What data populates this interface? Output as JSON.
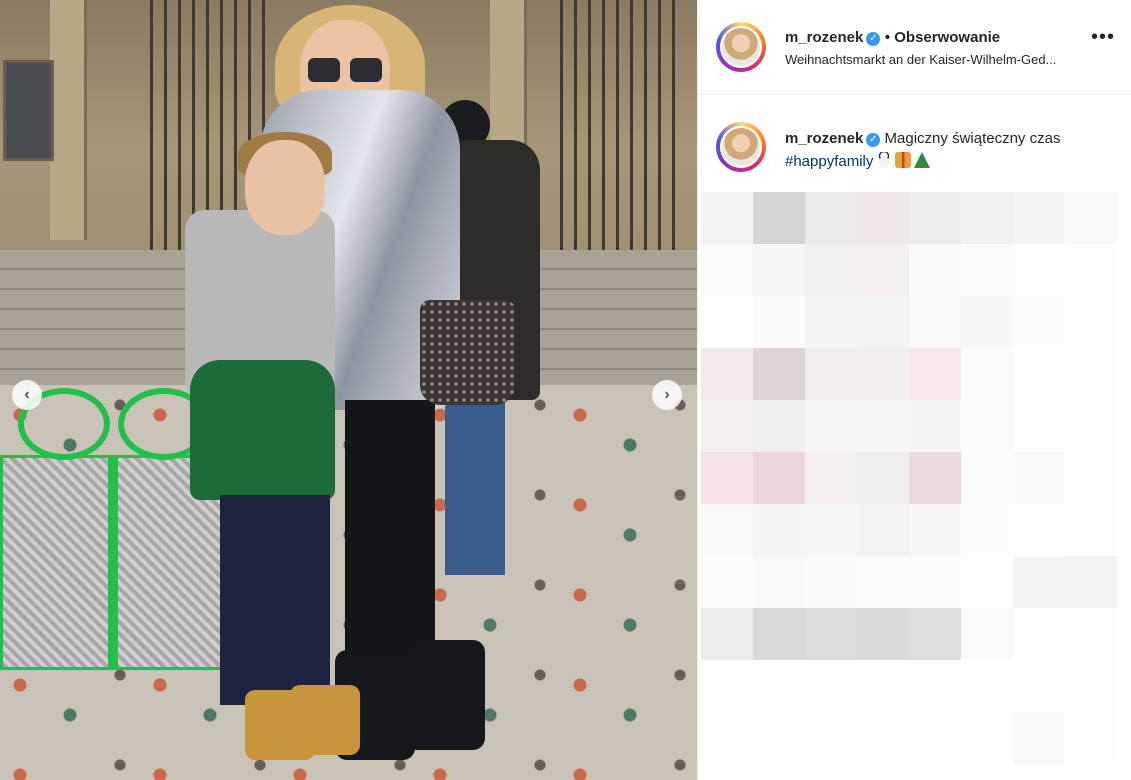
{
  "post": {
    "author": {
      "username": "m_rozenek",
      "verified": true,
      "follow_label": "• Obserwowanie",
      "location": "Weihnachtsmarkt an der Kaiser-Wilhelm-Ged..."
    },
    "more_options_label": "•••",
    "caption": {
      "username": "m_rozenek",
      "text_before": "Magiczny świąteczny czas",
      "hashtag": "#happyfamily",
      "emojis": [
        "snowman-icon",
        "gift-icon",
        "christmas-tree-icon"
      ]
    },
    "carousel": {
      "prev_label": "‹",
      "next_label": "›"
    }
  },
  "colors": {
    "accent_blue": "#3897f0",
    "hashtag": "#00376b",
    "text": "#262626",
    "border": "#efefef"
  },
  "pixelated_tiles": [
    "#f4f4f4",
    "#d6d6d6",
    "#eaeaea",
    "#efe6e6",
    "#ececec",
    "#f1f1f1",
    "#f5f5f5",
    "#fafafa",
    "#fbfbfb",
    "#f6f6f6",
    "#f1f1f1",
    "#f5f1f1",
    "#fafafa",
    "#fbfbfb",
    "#fdfdfd",
    "#fefefe",
    "#fdfdfd",
    "#fafafa",
    "#f5f5f5",
    "#f3f3f3",
    "#f8f8f8",
    "#f7f7f7",
    "#fcfcfc",
    "#fefefe",
    "#f2eaea",
    "#ddd5d5",
    "#f3eeee",
    "#f2eeee",
    "#f6e8e8",
    "#fbfbfb",
    "#fefefe",
    "#fefefe",
    "#f5f0f0",
    "#f1eeee",
    "#f7f7f7",
    "#f6f6f6",
    "#f5f5f5",
    "#fbfbfb",
    "#fefefe",
    "#fefefe",
    "#f3e1e3",
    "#ecd6d8",
    "#f4f0f0",
    "#f1eeee",
    "#eadadc",
    "#fbfbfb",
    "#fafafa",
    "#fefefe",
    "#fafafa",
    "#f5f5f5",
    "#f7f7f7",
    "#f3f3f3",
    "#f6f6f6",
    "#fcfcfc",
    "#fdfdfd",
    "#fefefe",
    "#fcfcfc",
    "#f9f9f9",
    "#fafafa",
    "#fbfbfb",
    "#fbfbfb",
    "#fdfdfd",
    "#f4f4f4",
    "#f3f3f3",
    "#ececec",
    "#d9d9d9",
    "#dcdcdc",
    "#dadada",
    "#dfdfdf",
    "#fbfbfb",
    "#fefefe",
    "#fefefe",
    "#fefefe",
    "#fdfdfd",
    "#fefefe",
    "#fefefe",
    "#fefefe",
    "#fefefe",
    "#fefefe",
    "#fefefe",
    "#fefefe",
    "#fdfdfd",
    "#fefefe",
    "#fefefe",
    "#fefefe",
    "#fefefe",
    "#f9f9f9",
    "#fefefe"
  ]
}
